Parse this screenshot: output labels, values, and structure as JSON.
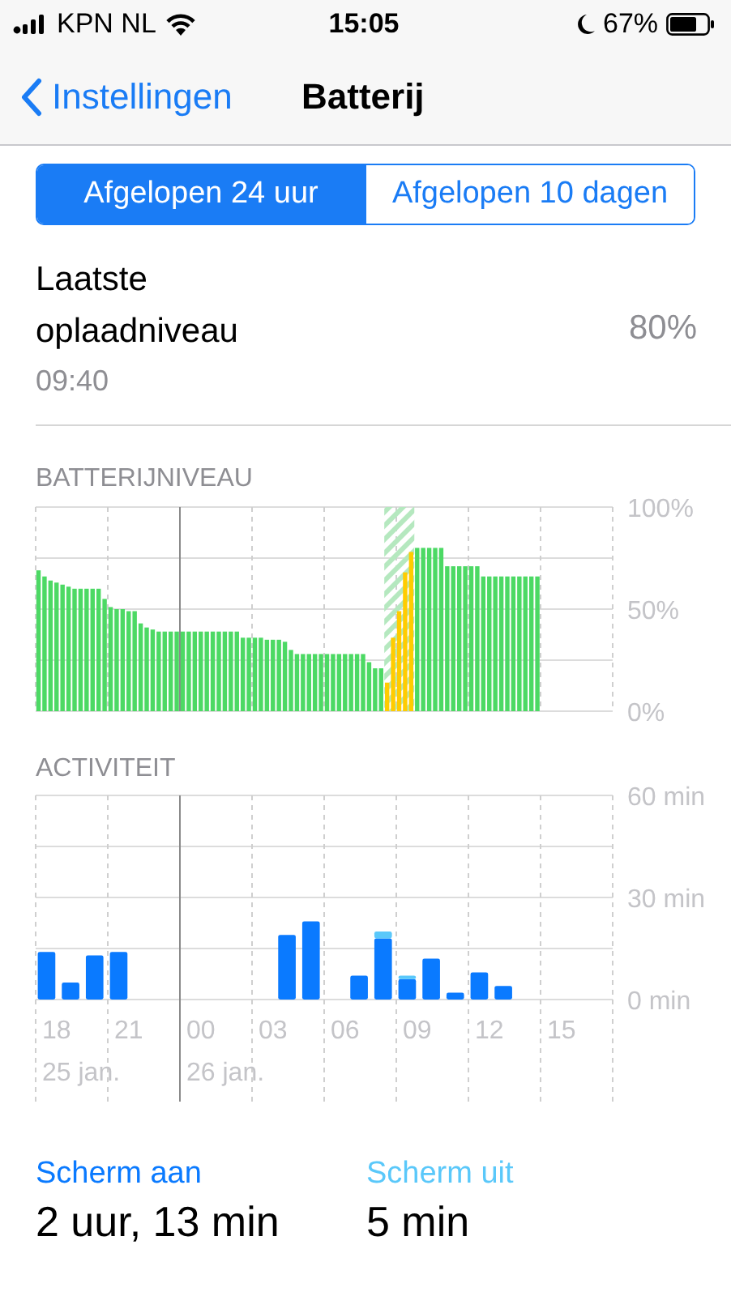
{
  "status_bar": {
    "carrier": "KPN NL",
    "time": "15:05",
    "battery": "67%"
  },
  "nav": {
    "back": "Instellingen",
    "title": "Batterij"
  },
  "segments": [
    {
      "label": "Afgelopen 24 uur",
      "selected": true
    },
    {
      "label": "Afgelopen 10 dagen",
      "selected": false
    }
  ],
  "last_charge": {
    "label": "Laatste oplaadniveau",
    "time": "09:40",
    "value": "80%"
  },
  "battery_level": {
    "title": "BATTERIJNIVEAU",
    "chart_data": {
      "type": "bar",
      "stacked": false,
      "grid": true,
      "ylim": [
        0,
        100
      ],
      "yticks": [
        {
          "value": 0,
          "label": "0%"
        },
        {
          "value": 50,
          "label": "50%"
        },
        {
          "value": 100,
          "label": "100%"
        }
      ],
      "series": [
        {
          "color": "#4cd964",
          "values": [
            69,
            66,
            64,
            63,
            62,
            61,
            60,
            60,
            60,
            60,
            60,
            55,
            51,
            50,
            50,
            49,
            49,
            43,
            41,
            40,
            39,
            39,
            39,
            39,
            39,
            39,
            39,
            39,
            39,
            39,
            39,
            39,
            39,
            39,
            36,
            36,
            36,
            36,
            35,
            35,
            35,
            34,
            30,
            28,
            28,
            28,
            28,
            28,
            28,
            28,
            28,
            28,
            28,
            28,
            28,
            24,
            21,
            21,
            null,
            null,
            null,
            null,
            null,
            80,
            80,
            80,
            80,
            80,
            71,
            71,
            71,
            71,
            71,
            71,
            66,
            66,
            66,
            66,
            66,
            66,
            66,
            66,
            66,
            66,
            null,
            null,
            null,
            null,
            null,
            null,
            null,
            null,
            null,
            null,
            null,
            null
          ]
        },
        {
          "color": "#ffcc00",
          "values": [
            null,
            null,
            null,
            null,
            null,
            null,
            null,
            null,
            null,
            null,
            null,
            null,
            null,
            null,
            null,
            null,
            null,
            null,
            null,
            null,
            null,
            null,
            null,
            null,
            null,
            null,
            null,
            null,
            null,
            null,
            null,
            null,
            null,
            null,
            null,
            null,
            null,
            null,
            null,
            null,
            null,
            null,
            null,
            null,
            null,
            null,
            null,
            null,
            null,
            null,
            null,
            null,
            null,
            null,
            null,
            null,
            null,
            null,
            14,
            36,
            49,
            68,
            78,
            null,
            null,
            null,
            null,
            null,
            null,
            null,
            null,
            null,
            null,
            null,
            null,
            null,
            null,
            null,
            null,
            null,
            null,
            null,
            null,
            null,
            null,
            null,
            null,
            null,
            null,
            null,
            null,
            null,
            null,
            null,
            null,
            null
          ]
        }
      ]
    }
  },
  "activity": {
    "title": "ACTIVITEIT",
    "chart_data": {
      "type": "bar",
      "stacked": true,
      "grid": true,
      "categories": [
        "18",
        null,
        null,
        "21",
        null,
        null,
        "00",
        null,
        null,
        "03",
        null,
        null,
        "06",
        null,
        null,
        "09",
        null,
        null,
        "12",
        null,
        null,
        "15",
        null,
        null
      ],
      "ylim": [
        0,
        60
      ],
      "yticks": [
        {
          "value": 0,
          "label": "0 min"
        },
        {
          "value": 30,
          "label": "30 min"
        },
        {
          "value": 60,
          "label": "60 min"
        }
      ],
      "series": [
        {
          "color": "#0a7aff",
          "values": [
            14,
            5,
            13,
            14,
            0,
            0,
            0,
            0,
            0,
            0,
            19,
            23,
            0,
            7,
            18,
            6,
            12,
            2,
            8,
            4,
            null,
            null,
            null,
            null
          ]
        },
        {
          "color": "#5ac8fa",
          "values": [
            0,
            0,
            0,
            0,
            0,
            0,
            0,
            0,
            0,
            0,
            0,
            0,
            0,
            0,
            2,
            1,
            0,
            0,
            0,
            0,
            null,
            null,
            null,
            null
          ]
        }
      ]
    },
    "date_labels": [
      "25 jan.",
      "26 jan."
    ]
  },
  "summary": [
    {
      "label": "Scherm aan",
      "value": "2 uur, 13 min",
      "color": "#0a7aff"
    },
    {
      "label": "Scherm uit",
      "value": "5 min",
      "color": "#5ac8fa"
    }
  ]
}
